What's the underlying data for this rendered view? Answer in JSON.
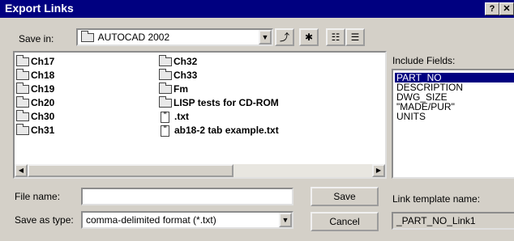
{
  "window": {
    "title": "Export Links",
    "help_button": "?",
    "close_button": "✕"
  },
  "save_in": {
    "label": "Save in:",
    "value": "AUTOCAD 2002"
  },
  "files": [
    {
      "name": "Ch17",
      "type": "folder"
    },
    {
      "name": "Ch18",
      "type": "folder"
    },
    {
      "name": "Ch19",
      "type": "folder"
    },
    {
      "name": "Ch20",
      "type": "folder"
    },
    {
      "name": "Ch30",
      "type": "folder"
    },
    {
      "name": "Ch31",
      "type": "folder"
    },
    {
      "name": "Ch32",
      "type": "folder"
    },
    {
      "name": "Ch33",
      "type": "folder"
    },
    {
      "name": "Fm",
      "type": "folder"
    },
    {
      "name": "LISP tests for CD-ROM",
      "type": "folder"
    },
    {
      "name": ".txt",
      "type": "file"
    },
    {
      "name": "ab18-2 tab example.txt",
      "type": "file"
    }
  ],
  "include_fields": {
    "label": "Include Fields:",
    "items": [
      "PART_NO",
      "DESCRIPTION",
      "DWG_SIZE",
      "\"MADE/PUR\"",
      "UNITS"
    ],
    "selected": "PART_NO"
  },
  "file_name": {
    "label": "File name:",
    "value": ""
  },
  "save_as_type": {
    "label": "Save as type:",
    "value": "comma-delimited format (*.txt)"
  },
  "buttons": {
    "save": "Save",
    "cancel": "Cancel"
  },
  "link_template": {
    "label": "Link template name:",
    "value": "_PART_NO_Link1"
  },
  "colors": {
    "title_bar": "#000080",
    "selection": "#000080",
    "face": "#d4d0c8"
  }
}
